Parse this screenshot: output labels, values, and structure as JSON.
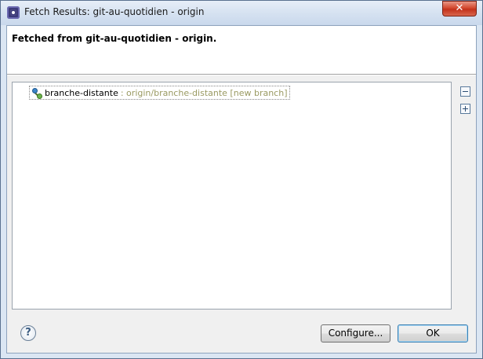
{
  "window": {
    "title": "Fetch Results: git-au-quotidien - origin",
    "close_glyph": "✕"
  },
  "header": {
    "title": "Fetched from git-au-quotidien - origin."
  },
  "results": {
    "items": [
      {
        "name": "branche-distante",
        "detail": ": origin/branche-distante [new branch]",
        "icon": "branch-icon"
      }
    ]
  },
  "tools": {
    "collapse_icon": "collapse-all-icon",
    "expand_icon": "expand-all-icon"
  },
  "footer": {
    "help_glyph": "?",
    "configure_label": "Configure...",
    "ok_label": "OK"
  },
  "colors": {
    "detail_text": "#9a9a62",
    "title_bar": "#d6e2f1",
    "close_button": "#c3321b"
  }
}
